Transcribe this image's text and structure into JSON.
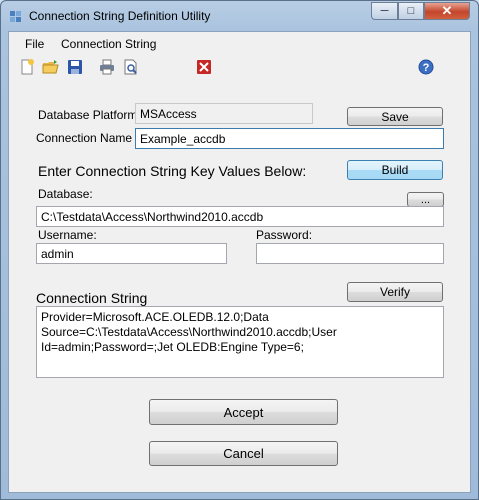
{
  "window": {
    "title": "Connection String Definition Utility",
    "controls": {
      "minimize": "─",
      "maximize": "□",
      "close": "✕"
    }
  },
  "menu": [
    "File",
    "Connection String"
  ],
  "toolbar": {
    "icons": [
      "new-file-icon",
      "open-folder-icon",
      "save-disk-icon",
      "print-icon",
      "print-preview-icon",
      "close-red-x-icon",
      "help-icon"
    ],
    "accent": {
      "close": "#c62828",
      "help": "#3a6fc4"
    }
  },
  "form": {
    "platform_label": "Database Platform",
    "platform_value": "MSAccess",
    "save_label": "Save",
    "name_label": "Connection Name",
    "name_value": "Example_accdb",
    "enter_label": "Enter Connection String Key Values Below:",
    "build_label": "Build",
    "database_label": "Database:",
    "browse_label": "...",
    "database_value": "C:\\Testdata\\Access\\Northwind2010.accdb",
    "username_label": "Username:",
    "username_value": "admin",
    "password_label": "Password:",
    "password_value": "",
    "connstr_label": "Connection String",
    "verify_label": "Verify",
    "connstr_value": "Provider=Microsoft.ACE.OLEDB.12.0;Data Source=C:\\Testdata\\Access\\Northwind2010.accdb;User Id=admin;Password=;Jet OLEDB:Engine Type=6;",
    "accept_label": "Accept",
    "cancel_label": "Cancel"
  }
}
